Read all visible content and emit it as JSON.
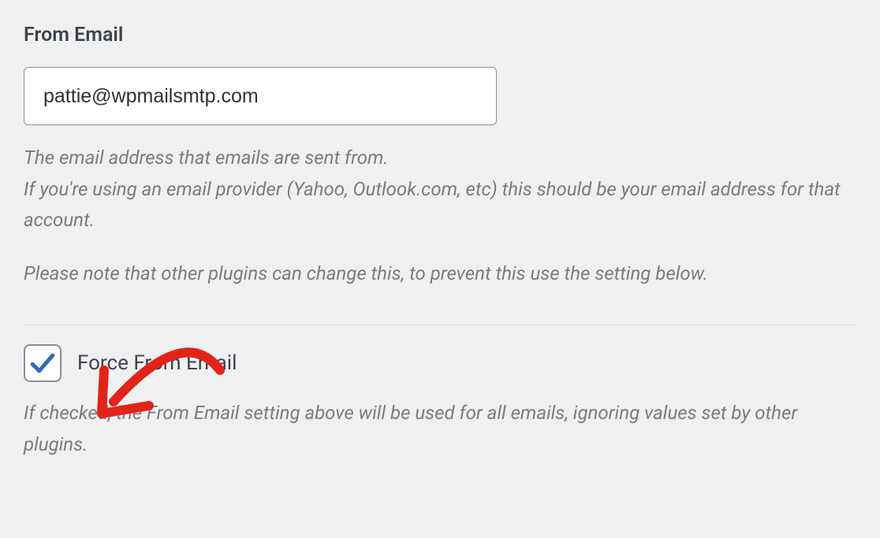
{
  "from_email": {
    "label": "From Email",
    "value": "pattie@wpmailsmtp.com",
    "help_line1": "The email address that emails are sent from.",
    "help_line2": "If you're using an email provider (Yahoo, Outlook.com, etc) this should be your email address for that account.",
    "help_line3": "Please note that other plugins can change this, to prevent this use the setting below."
  },
  "force_from_email": {
    "label": "Force From Email",
    "checked": true,
    "help": "If checked, the From Email setting above will be used for all emails, ignoring values set by other plugins."
  },
  "colors": {
    "annotation": "#e2231a",
    "check": "#2c6bb0"
  }
}
